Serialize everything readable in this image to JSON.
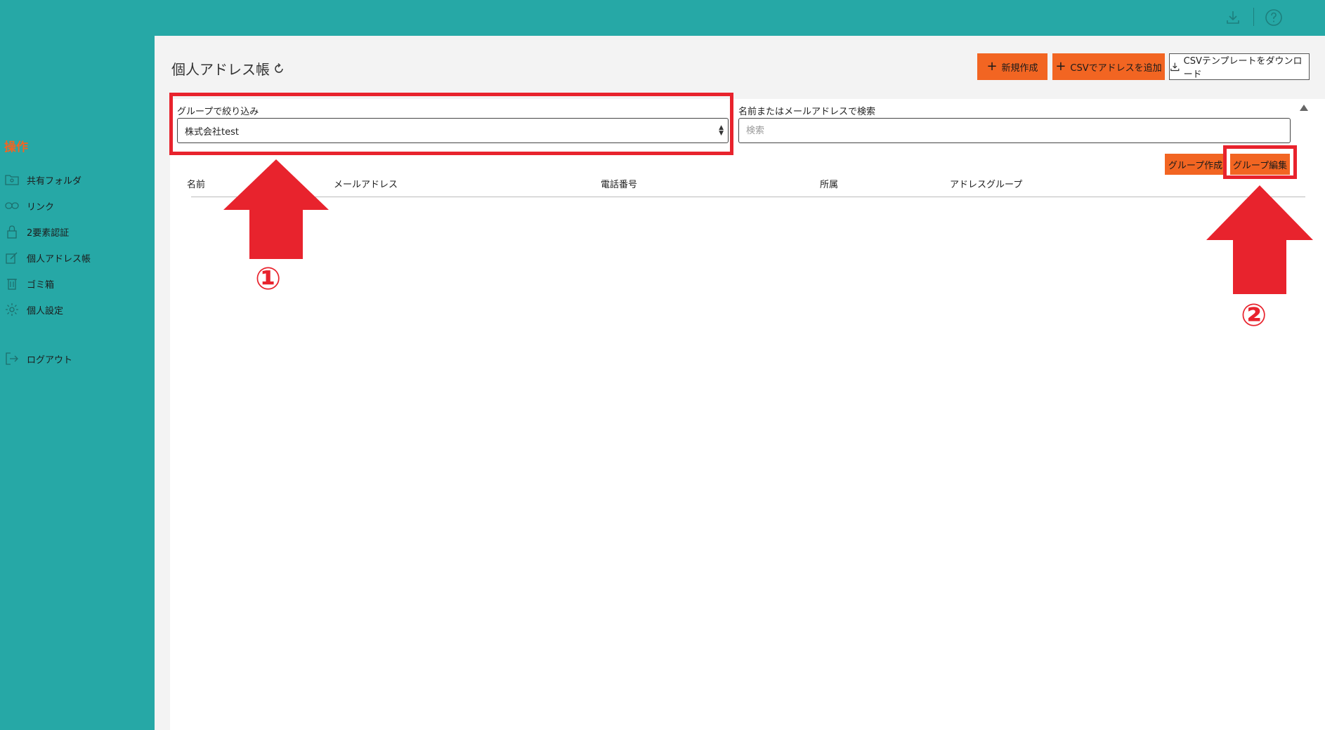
{
  "colors": {
    "teal": "#26a8a6",
    "orange": "#f26522",
    "annotation_red": "#e8232d"
  },
  "topbar": {
    "download_icon": "download-icon",
    "help_icon": "help-icon"
  },
  "sidebar": {
    "heading": "操作",
    "items": [
      {
        "label": "共有フォルダ",
        "icon": "folder-icon"
      },
      {
        "label": "リンク",
        "icon": "link-icon"
      },
      {
        "label": "2要素認証",
        "icon": "lock-icon"
      },
      {
        "label": "個人アドレス帳",
        "icon": "edit-icon"
      },
      {
        "label": "ゴミ箱",
        "icon": "trash-icon"
      },
      {
        "label": "個人設定",
        "icon": "gear-icon"
      }
    ],
    "logout": {
      "label": "ログアウト",
      "icon": "logout-icon"
    }
  },
  "main": {
    "title": "個人アドレス帳",
    "buttons": {
      "new": "新規作成",
      "csv_add": "CSVでアドレスを追加",
      "csv_template": "CSVテンプレートをダウンロード"
    },
    "filter": {
      "label": "グループで絞り込み",
      "selected": "株式会社test"
    },
    "search": {
      "label": "名前またはメールアドレスで検索",
      "placeholder": "検索"
    },
    "group_buttons": {
      "create": "グループ作成",
      "edit": "グループ編集"
    },
    "table": {
      "columns": [
        "名前",
        "メールアドレス",
        "電話番号",
        "所属",
        "アドレスグループ"
      ]
    }
  },
  "annotations": {
    "one": "①",
    "two": "②"
  }
}
